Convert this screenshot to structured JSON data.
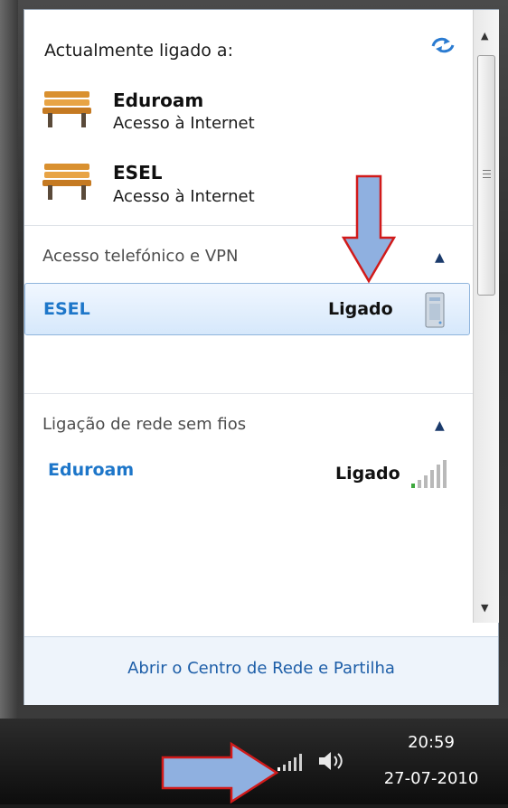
{
  "panel": {
    "header": "Actualmente ligado a:",
    "connections": [
      {
        "name": "Eduroam",
        "status": "Acesso à Internet",
        "icon": "bench-icon"
      },
      {
        "name": "ESEL",
        "status": "Acesso à Internet",
        "icon": "bench-icon"
      }
    ],
    "sections": [
      {
        "title": "Acesso telefónico e VPN",
        "items": [
          {
            "name": "ESEL",
            "status": "Ligado",
            "icon": "vpn-server-icon"
          }
        ]
      },
      {
        "title": "Ligação de rede sem fios",
        "items": [
          {
            "name": "Eduroam",
            "status": "Ligado",
            "icon": "signal-bars-icon"
          }
        ]
      }
    ],
    "footer_link": "Abrir o Centro de Rede e Partilha"
  },
  "taskbar": {
    "time": "20:59",
    "date": "27-07-2010"
  },
  "colors": {
    "accent_blue": "#1d76c9",
    "annotation_arrow_fill": "#8fb0e0",
    "annotation_arrow_border": "#d11a1a"
  }
}
